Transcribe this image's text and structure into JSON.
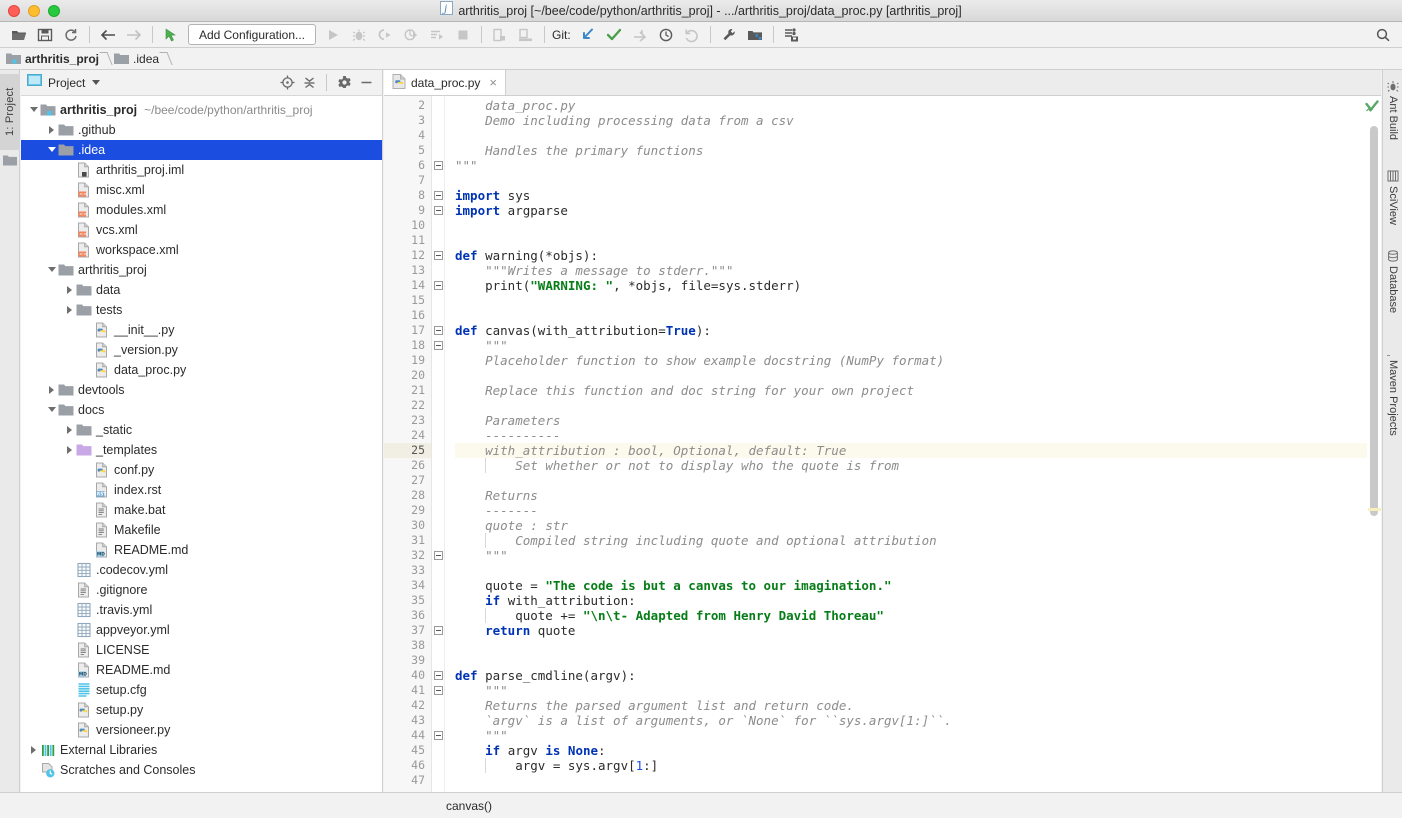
{
  "window": {
    "title": "arthritis_proj [~/bee/code/python/arthritis_proj] - .../arthritis_proj/data_proc.py [arthritis_proj]",
    "traffic_lights": [
      "close-red",
      "minimize-yellow",
      "maximize-green"
    ]
  },
  "toolbar": {
    "open_label": "Open",
    "save_label": "Save All",
    "sync_label": "Synchronize",
    "back_label": "Back",
    "forward_label": "Forward",
    "pointer_label": "Select In",
    "add_configuration": "Add Configuration...",
    "run_label": "Run",
    "debug_label": "Debug",
    "run_coverage_label": "Run with Coverage",
    "profile_label": "Profile",
    "run_console_label": "Run Console",
    "stop_label": "Stop",
    "git_label": "Git:",
    "update_project_label": "Update Project",
    "commit_label": "Commit",
    "push_label": "Push",
    "history_label": "History",
    "rollback_label": "Rollback",
    "settings_label": "Settings",
    "project_structure_label": "Project Structure",
    "database_label": "Database",
    "search_label": "Search Everywhere",
    "accent_blue": "#3b87c8",
    "accent_green": "#4a9e4a"
  },
  "breadcrumb": {
    "items": [
      {
        "label": "arthritis_proj",
        "icon": "project-folder-icon",
        "bold": true
      },
      {
        "label": ".idea",
        "icon": "folder-icon",
        "bold": false
      }
    ]
  },
  "left_strip": {
    "project_label": "1: Project"
  },
  "right_strip": {
    "items": [
      {
        "label": "Ant Build",
        "icon": "ant-icon"
      },
      {
        "label": "SciView",
        "icon": "sciview-icon"
      },
      {
        "label": "Database",
        "icon": "database-icon"
      },
      {
        "label": "Maven Projects",
        "icon": "maven-icon"
      }
    ]
  },
  "project_panel": {
    "title": "Project",
    "view_icon": "project-view-icon",
    "dropdown_icon": "chevron-down-icon",
    "locate_label": "Select Opened File",
    "collapse_label": "Collapse All",
    "settings_label": "Show Options Menu",
    "hide_label": "Hide",
    "tree": [
      {
        "label": "arthritis_proj",
        "path": "~/bee/code/python/arthritis_proj",
        "depth": 0,
        "arrow": "open",
        "icon": "project-root-icon",
        "bold": true,
        "selected": false
      },
      {
        "label": ".github",
        "depth": 1,
        "arrow": "closed",
        "icon": "folder-icon",
        "selected": false
      },
      {
        "label": ".idea",
        "depth": 1,
        "arrow": "open",
        "icon": "folder-icon",
        "selected": true
      },
      {
        "label": "arthritis_proj.iml",
        "depth": 2,
        "arrow": "none",
        "icon": "iml-file-icon",
        "selected": false
      },
      {
        "label": "misc.xml",
        "depth": 2,
        "arrow": "none",
        "icon": "xml-file-icon",
        "selected": false
      },
      {
        "label": "modules.xml",
        "depth": 2,
        "arrow": "none",
        "icon": "xml-file-icon",
        "selected": false
      },
      {
        "label": "vcs.xml",
        "depth": 2,
        "arrow": "none",
        "icon": "xml-file-icon",
        "selected": false
      },
      {
        "label": "workspace.xml",
        "depth": 2,
        "arrow": "none",
        "icon": "xml-file-icon",
        "selected": false
      },
      {
        "label": "arthritis_proj",
        "depth": 1,
        "arrow": "open",
        "icon": "folder-icon",
        "selected": false
      },
      {
        "label": "data",
        "depth": 2,
        "arrow": "closed",
        "icon": "folder-icon",
        "selected": false
      },
      {
        "label": "tests",
        "depth": 2,
        "arrow": "closed",
        "icon": "folder-icon",
        "selected": false
      },
      {
        "label": "__init__.py",
        "depth": 3,
        "arrow": "none",
        "icon": "python-file-icon",
        "selected": false
      },
      {
        "label": "_version.py",
        "depth": 3,
        "arrow": "none",
        "icon": "python-file-icon",
        "selected": false
      },
      {
        "label": "data_proc.py",
        "depth": 3,
        "arrow": "none",
        "icon": "python-file-icon",
        "selected": false
      },
      {
        "label": "devtools",
        "depth": 1,
        "arrow": "closed",
        "icon": "folder-icon",
        "selected": false
      },
      {
        "label": "docs",
        "depth": 1,
        "arrow": "open",
        "icon": "folder-icon",
        "selected": false
      },
      {
        "label": "_static",
        "depth": 2,
        "arrow": "closed",
        "icon": "folder-icon",
        "selected": false
      },
      {
        "label": "_templates",
        "depth": 2,
        "arrow": "closed",
        "icon": "folder-purple-icon",
        "selected": false
      },
      {
        "label": "conf.py",
        "depth": 3,
        "arrow": "none",
        "icon": "python-file-icon",
        "selected": false
      },
      {
        "label": "index.rst",
        "depth": 3,
        "arrow": "none",
        "icon": "rst-file-icon",
        "selected": false
      },
      {
        "label": "make.bat",
        "depth": 3,
        "arrow": "none",
        "icon": "text-file-icon",
        "selected": false
      },
      {
        "label": "Makefile",
        "depth": 3,
        "arrow": "none",
        "icon": "text-file-icon",
        "selected": false
      },
      {
        "label": "README.md",
        "depth": 3,
        "arrow": "none",
        "icon": "markdown-file-icon",
        "selected": false
      },
      {
        "label": ".codecov.yml",
        "depth": 2,
        "arrow": "none",
        "icon": "yaml-file-icon",
        "selected": false
      },
      {
        "label": ".gitignore",
        "depth": 2,
        "arrow": "none",
        "icon": "text-file-icon",
        "selected": false
      },
      {
        "label": ".travis.yml",
        "depth": 2,
        "arrow": "none",
        "icon": "yaml-file-icon",
        "selected": false
      },
      {
        "label": "appveyor.yml",
        "depth": 2,
        "arrow": "none",
        "icon": "yaml-file-icon",
        "selected": false
      },
      {
        "label": "LICENSE",
        "depth": 2,
        "arrow": "none",
        "icon": "text-file-icon",
        "selected": false
      },
      {
        "label": "README.md",
        "depth": 2,
        "arrow": "none",
        "icon": "markdown-file-icon",
        "selected": false
      },
      {
        "label": "setup.cfg",
        "depth": 2,
        "arrow": "none",
        "icon": "config-file-icon",
        "selected": false
      },
      {
        "label": "setup.py",
        "depth": 2,
        "arrow": "none",
        "icon": "python-file-icon",
        "selected": false
      },
      {
        "label": "versioneer.py",
        "depth": 2,
        "arrow": "none",
        "icon": "python-file-icon",
        "selected": false
      },
      {
        "label": "External Libraries",
        "depth": 0,
        "arrow": "closed",
        "icon": "libraries-icon",
        "selected": false
      },
      {
        "label": "Scratches and Consoles",
        "depth": 0,
        "arrow": "none",
        "icon": "scratches-icon",
        "selected": false
      }
    ]
  },
  "editor": {
    "tabs": [
      {
        "label": "data_proc.py",
        "icon": "python-file-icon",
        "close": "×",
        "active": true
      }
    ],
    "inspection_status": "ok-green-check",
    "first_line_number": 2,
    "highlight_line": 25,
    "lines": [
      {
        "n": 2,
        "tokens": [
          {
            "t": "    ",
            "c": ""
          },
          {
            "t": "data_proc.py",
            "c": "doc"
          }
        ]
      },
      {
        "n": 3,
        "tokens": [
          {
            "t": "    ",
            "c": ""
          },
          {
            "t": "Demo including processing data from a csv",
            "c": "doc"
          }
        ]
      },
      {
        "n": 4,
        "tokens": []
      },
      {
        "n": 5,
        "tokens": [
          {
            "t": "    ",
            "c": ""
          },
          {
            "t": "Handles the primary functions",
            "c": "doc"
          }
        ]
      },
      {
        "n": 6,
        "tokens": [
          {
            "t": "\"\"\"",
            "c": "docq"
          }
        ]
      },
      {
        "n": 7,
        "tokens": []
      },
      {
        "n": 8,
        "tokens": [
          {
            "t": "import",
            "c": "kw"
          },
          {
            "t": " sys",
            "c": ""
          }
        ]
      },
      {
        "n": 9,
        "tokens": [
          {
            "t": "import",
            "c": "kw"
          },
          {
            "t": " argparse",
            "c": ""
          }
        ]
      },
      {
        "n": 10,
        "tokens": []
      },
      {
        "n": 11,
        "tokens": []
      },
      {
        "n": 12,
        "tokens": [
          {
            "t": "def",
            "c": "kw"
          },
          {
            "t": " warning(*objs):",
            "c": ""
          }
        ]
      },
      {
        "n": 13,
        "tokens": [
          {
            "t": "    ",
            "c": ""
          },
          {
            "t": "\"\"\"",
            "c": "docq"
          },
          {
            "t": "Writes a message to stderr.",
            "c": "doc"
          },
          {
            "t": "\"\"\"",
            "c": "docq"
          }
        ]
      },
      {
        "n": 14,
        "tokens": [
          {
            "t": "    print(",
            "c": ""
          },
          {
            "t": "\"WARNING: \"",
            "c": "str"
          },
          {
            "t": ", *objs, file=sys.stderr)",
            "c": ""
          }
        ]
      },
      {
        "n": 15,
        "tokens": []
      },
      {
        "n": 16,
        "tokens": []
      },
      {
        "n": 17,
        "tokens": [
          {
            "t": "def",
            "c": "kw"
          },
          {
            "t": " canvas(with_attribution=",
            "c": ""
          },
          {
            "t": "True",
            "c": "kw"
          },
          {
            "t": "):",
            "c": ""
          }
        ]
      },
      {
        "n": 18,
        "tokens": [
          {
            "t": "    ",
            "c": ""
          },
          {
            "t": "\"\"\"",
            "c": "docq"
          }
        ]
      },
      {
        "n": 19,
        "tokens": [
          {
            "t": "    ",
            "c": ""
          },
          {
            "t": "Placeholder function to show example docstring (NumPy format)",
            "c": "doc"
          }
        ]
      },
      {
        "n": 20,
        "tokens": []
      },
      {
        "n": 21,
        "tokens": [
          {
            "t": "    ",
            "c": ""
          },
          {
            "t": "Replace this function and doc string for your own project",
            "c": "doc"
          }
        ]
      },
      {
        "n": 22,
        "tokens": []
      },
      {
        "n": 23,
        "tokens": [
          {
            "t": "    ",
            "c": ""
          },
          {
            "t": "Parameters",
            "c": "doc"
          }
        ]
      },
      {
        "n": 24,
        "tokens": [
          {
            "t": "    ",
            "c": ""
          },
          {
            "t": "----------",
            "c": "doc"
          }
        ]
      },
      {
        "n": 25,
        "tokens": [
          {
            "t": "    ",
            "c": ""
          },
          {
            "t": "with_attribution : bool, Optional, default: True",
            "c": "doc"
          }
        ]
      },
      {
        "n": 26,
        "tokens": [
          {
            "t": "        ",
            "c": ""
          },
          {
            "t": "Set whether or not to display who the quote is from",
            "c": "doc"
          }
        ]
      },
      {
        "n": 27,
        "tokens": []
      },
      {
        "n": 28,
        "tokens": [
          {
            "t": "    ",
            "c": ""
          },
          {
            "t": "Returns",
            "c": "doc"
          }
        ]
      },
      {
        "n": 29,
        "tokens": [
          {
            "t": "    ",
            "c": ""
          },
          {
            "t": "-------",
            "c": "doc"
          }
        ]
      },
      {
        "n": 30,
        "tokens": [
          {
            "t": "    ",
            "c": ""
          },
          {
            "t": "quote : str",
            "c": "doc"
          }
        ]
      },
      {
        "n": 31,
        "tokens": [
          {
            "t": "        ",
            "c": ""
          },
          {
            "t": "Compiled string including quote and optional attribution",
            "c": "doc"
          }
        ]
      },
      {
        "n": 32,
        "tokens": [
          {
            "t": "    ",
            "c": ""
          },
          {
            "t": "\"\"\"",
            "c": "docq"
          }
        ]
      },
      {
        "n": 33,
        "tokens": []
      },
      {
        "n": 34,
        "tokens": [
          {
            "t": "    quote = ",
            "c": ""
          },
          {
            "t": "\"The code is but a canvas to our imagination.\"",
            "c": "str"
          }
        ]
      },
      {
        "n": 35,
        "tokens": [
          {
            "t": "    ",
            "c": ""
          },
          {
            "t": "if",
            "c": "kw"
          },
          {
            "t": " with_attribution:",
            "c": ""
          }
        ]
      },
      {
        "n": 36,
        "tokens": [
          {
            "t": "        quote += ",
            "c": ""
          },
          {
            "t": "\"\\n\\t- Adapted from Henry David Thoreau\"",
            "c": "str"
          }
        ]
      },
      {
        "n": 37,
        "tokens": [
          {
            "t": "    ",
            "c": ""
          },
          {
            "t": "return",
            "c": "kw"
          },
          {
            "t": " quote",
            "c": ""
          }
        ]
      },
      {
        "n": 38,
        "tokens": []
      },
      {
        "n": 39,
        "tokens": []
      },
      {
        "n": 40,
        "tokens": [
          {
            "t": "def",
            "c": "kw"
          },
          {
            "t": " parse_cmdline(argv):",
            "c": ""
          }
        ]
      },
      {
        "n": 41,
        "tokens": [
          {
            "t": "    ",
            "c": ""
          },
          {
            "t": "\"\"\"",
            "c": "docq"
          }
        ]
      },
      {
        "n": 42,
        "tokens": [
          {
            "t": "    ",
            "c": ""
          },
          {
            "t": "Returns the parsed argument list and return code.",
            "c": "doc"
          }
        ]
      },
      {
        "n": 43,
        "tokens": [
          {
            "t": "    ",
            "c": ""
          },
          {
            "t": "`argv` is a list of arguments, or `None` for ``sys.argv[1:]``.",
            "c": "doc"
          }
        ]
      },
      {
        "n": 44,
        "tokens": [
          {
            "t": "    ",
            "c": ""
          },
          {
            "t": "\"\"\"",
            "c": "docq"
          }
        ]
      },
      {
        "n": 45,
        "tokens": [
          {
            "t": "    ",
            "c": ""
          },
          {
            "t": "if",
            "c": "kw"
          },
          {
            "t": " argv ",
            "c": ""
          },
          {
            "t": "is",
            "c": "kw"
          },
          {
            "t": " ",
            "c": ""
          },
          {
            "t": "None",
            "c": "kw"
          },
          {
            "t": ":",
            "c": ""
          }
        ]
      },
      {
        "n": 46,
        "tokens": [
          {
            "t": "        argv = sys.argv[",
            "c": ""
          },
          {
            "t": "1",
            "c": "num"
          },
          {
            "t": ":]",
            "c": ""
          }
        ]
      },
      {
        "n": 47,
        "tokens": []
      }
    ]
  },
  "statusbar": {
    "breadcrumb_text": "canvas()"
  }
}
